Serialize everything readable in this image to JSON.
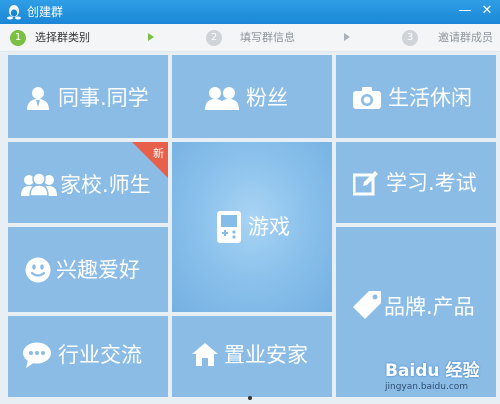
{
  "window": {
    "title": "创建群",
    "minimize_glyph": "—",
    "close_glyph": "✕",
    "logo_icon": "qq-penguin-icon"
  },
  "steps": [
    {
      "number": "1",
      "label": "选择群类别",
      "state": "active"
    },
    {
      "number": "2",
      "label": "填写群信息",
      "state": "inactive"
    },
    {
      "number": "3",
      "label": "邀请群成员",
      "state": "inactive"
    }
  ],
  "categories": {
    "colleagues": {
      "label": "同事.同学",
      "icon": "person-icon"
    },
    "fans": {
      "label": "粉丝",
      "icon": "people-icon"
    },
    "lifestyle": {
      "label": "生活休闲",
      "icon": "camera-icon"
    },
    "school": {
      "label": "家校.师生",
      "icon": "group-icon",
      "badge": "新"
    },
    "games": {
      "label": "游戏",
      "icon": "gamepad-icon"
    },
    "study": {
      "label": "学习.考试",
      "icon": "edit-icon"
    },
    "hobbies": {
      "label": "兴趣爱好",
      "icon": "smile-icon"
    },
    "brand": {
      "label": "品牌.产品",
      "icon": "tag-icon"
    },
    "industry": {
      "label": "行业交流",
      "icon": "chat-icon"
    },
    "realestate": {
      "label": "置业安家",
      "icon": "house-icon"
    }
  },
  "watermark": {
    "text": "Baidu 经验",
    "url": "jingyan.baidu.com"
  },
  "colors": {
    "tile": "#8bbce6",
    "tile_center": "#8cc2ec",
    "titlebar": "#1b86d6",
    "step_active": "#7bc043",
    "badge": "#e8604a"
  }
}
